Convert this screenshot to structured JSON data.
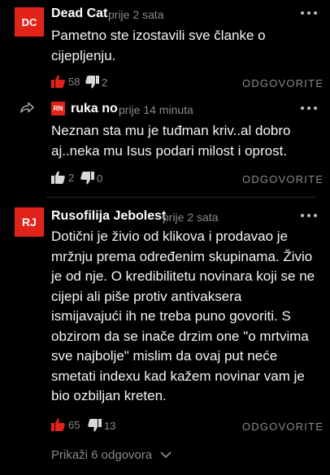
{
  "colors": {
    "accent": "#e2231a",
    "muted": "#8a8a8a",
    "background": "#000000",
    "text": "#f4f4f4"
  },
  "comments": [
    {
      "avatar": "DC",
      "author": "Dead Cat",
      "time": "prije 2 sata",
      "lines": [
        "Pametno ste izostavili sve članke o",
        "cijepljenju."
      ],
      "likes": "58",
      "dislikes": "2",
      "reply_label": "ODGOVORITE"
    },
    {
      "avatar": "RN",
      "author": "ruka no",
      "time": "prije 14 minuta",
      "lines": [
        "Neznan sta mu je tuđman kriv..al dobro",
        "aj..neka mu Isus podari milost i oprost."
      ],
      "likes": "2",
      "dislikes": "0",
      "reply_label": "ODGOVORITE"
    },
    {
      "avatar": "RJ",
      "author": "Rusofilija Jebolest",
      "time": "prije 2 sata",
      "lines": [
        "Dotični je živio od klikova i prodavao je",
        "mržnju prema određenim skupinama. Živio",
        "je od nje. O kredibilitetu novinara koji se ne",
        "cijepi ali piše protiv antivaksera",
        "ismijavajući ih ne treba puno govoriti. S",
        "obzirom da se inače drzim one \"o mrtvima",
        "sve najbolje\" mislim da ovaj put neće",
        "smetati indexu kad kažem novinar vam je",
        "bio ozbiljan kreten."
      ],
      "likes": "65",
      "dislikes": "13",
      "reply_label": "ODGOVORITE"
    }
  ],
  "more_replies_label": "Prikaži 6 odgovora",
  "icons": {
    "like": "thumbs-up-icon",
    "dislike": "thumbs-down-icon",
    "more": "more-dots-icon",
    "reply": "reply-arrow-icon",
    "expand": "chevron-down-icon"
  }
}
